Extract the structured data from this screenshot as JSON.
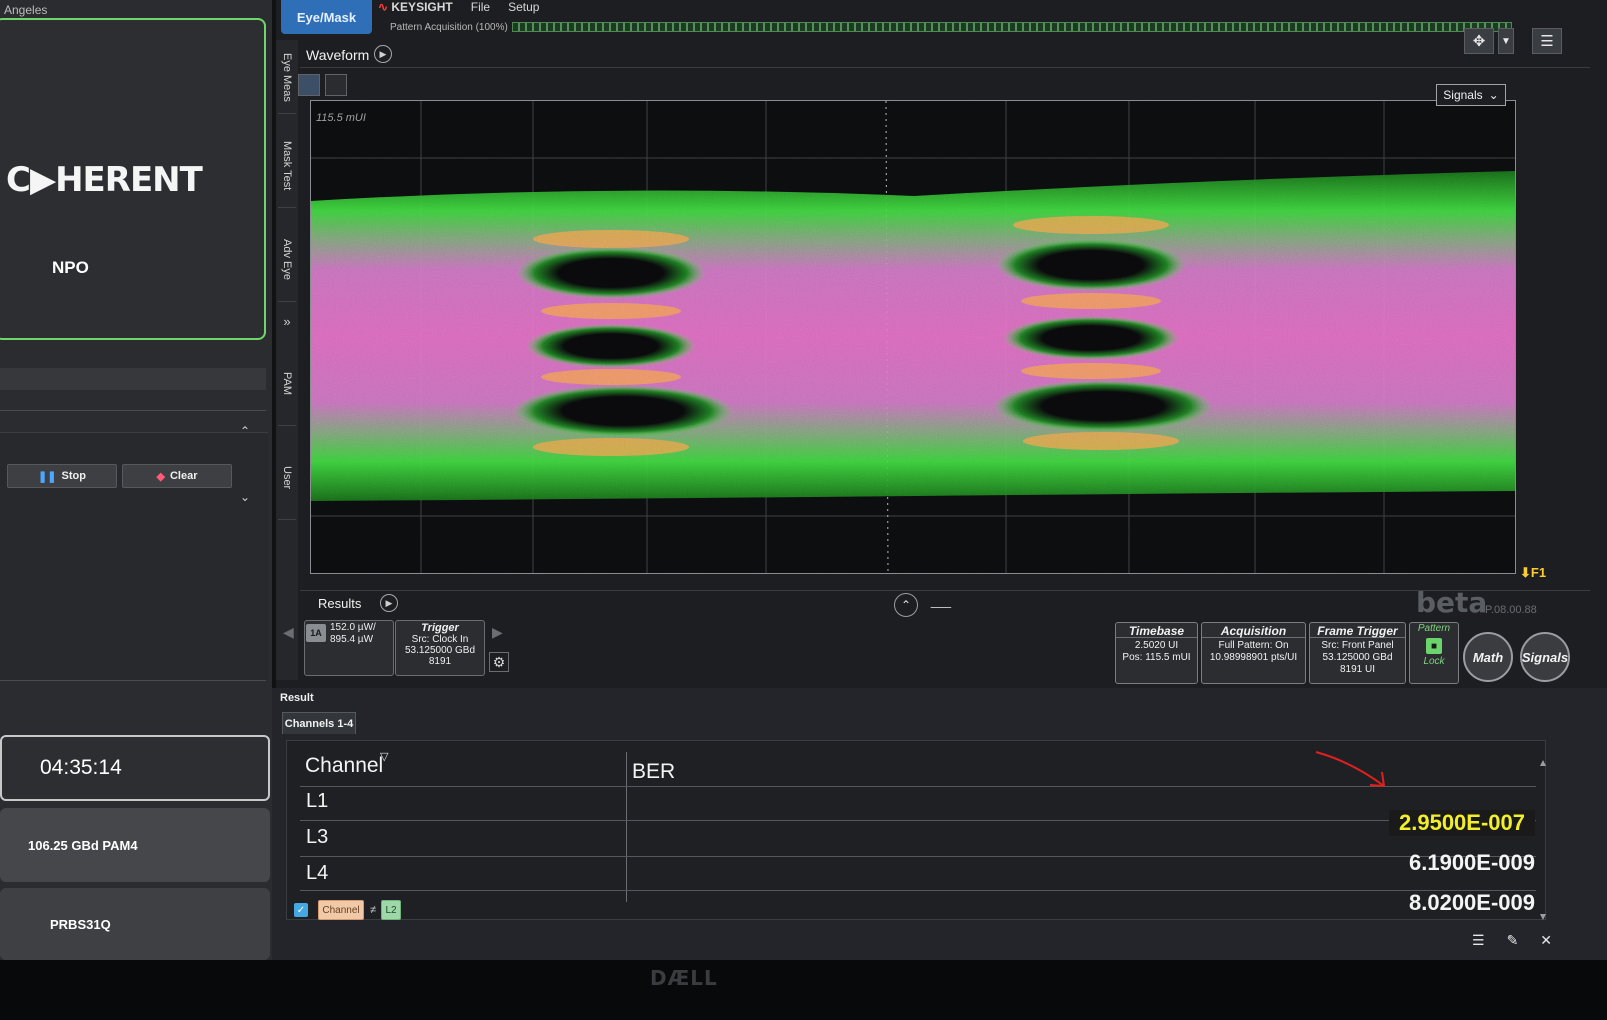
{
  "left_panel": {
    "location": "Angeles",
    "logo_text": "C▶HERENT",
    "product": "NPO",
    "stop_label": "Stop",
    "clear_label": "Clear",
    "elapsed_time": "04:35:14",
    "data_rate": "106.25 GBd PAM4",
    "pattern": "PRBS31Q"
  },
  "scope": {
    "mode_tab": "Eye/Mask",
    "brand": "KEYSIGHT",
    "menus": [
      "File",
      "Setup"
    ],
    "acquisition_status": "Pattern Acquisition  (100%)",
    "side_tabs": [
      "Eye Meas",
      "Mask Test",
      "Adv Eye",
      "PAM",
      "User"
    ],
    "waveform_label": "Waveform",
    "scale_label": "115.5 mUI",
    "signals_dropdown": "Signals",
    "marker_label": "F1",
    "results_label": "Results",
    "beta_label": "beta",
    "version": "P.08.00.88",
    "channel": {
      "badge": "1A",
      "line1": "152.0 µW/",
      "line2": "895.4 µW"
    },
    "trigger": {
      "title": "Trigger",
      "src": "Src: Clock In",
      "rate": "53.125000 GBd",
      "pattern_len": "8191"
    },
    "timebase": {
      "title": "Timebase",
      "line1": "2.5020 UI",
      "line2": "Pos: 115.5 mUI"
    },
    "acquisition": {
      "title": "Acquisition",
      "line1": "Full Pattern: On",
      "line2": "10.98998901 pts/UI"
    },
    "frame_trigger": {
      "title": "Frame Trigger",
      "line1": "Src: Front Panel",
      "line2": "53.125000 GBd",
      "line3": "8191 UI"
    },
    "pattern_lock": {
      "title": "Pattern",
      "status": "Lock"
    },
    "math_btn": "Math",
    "signals_btn": "Signals"
  },
  "result": {
    "title": "Result",
    "tab": "Channels 1-4",
    "headers": {
      "channel": "Channel",
      "ber": "BER"
    },
    "rows": [
      {
        "channel": "L1",
        "ber": "2.9500E-007"
      },
      {
        "channel": "L3",
        "ber": "6.1900E-009"
      },
      {
        "channel": "L4",
        "ber": "8.0200E-009"
      }
    ],
    "filter_chip": "Channel",
    "filter_op": "≠",
    "filter_value": "L2"
  },
  "colors": {
    "accent_green": "#6fd66a",
    "highlight_yellow": "#f2ef2a",
    "eye_green": "#3fdc3f",
    "eye_pink": "#e86fc8",
    "eye_orange": "#f3a04a",
    "tab_blue": "#2e6fb8"
  },
  "bezel_brand": "DÆLL"
}
